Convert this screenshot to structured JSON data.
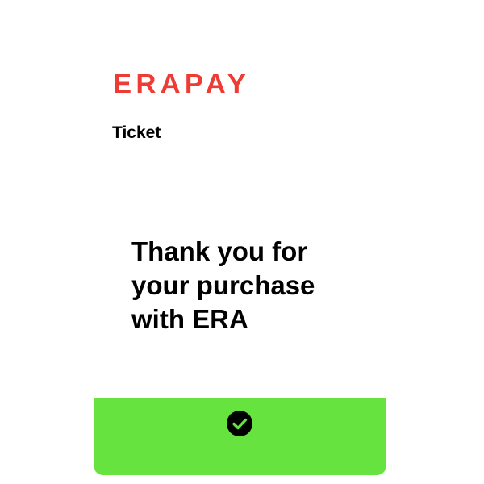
{
  "brand": {
    "logo_text": "ERAPAY",
    "logo_color": "#ee3b34"
  },
  "header": {
    "subtitle": "Ticket"
  },
  "main": {
    "message_lines": [
      "Thank you for",
      "your purchase",
      "with ERA"
    ]
  },
  "confirm_bar": {
    "icon": "check-circle-icon",
    "color": "#66e33f"
  }
}
